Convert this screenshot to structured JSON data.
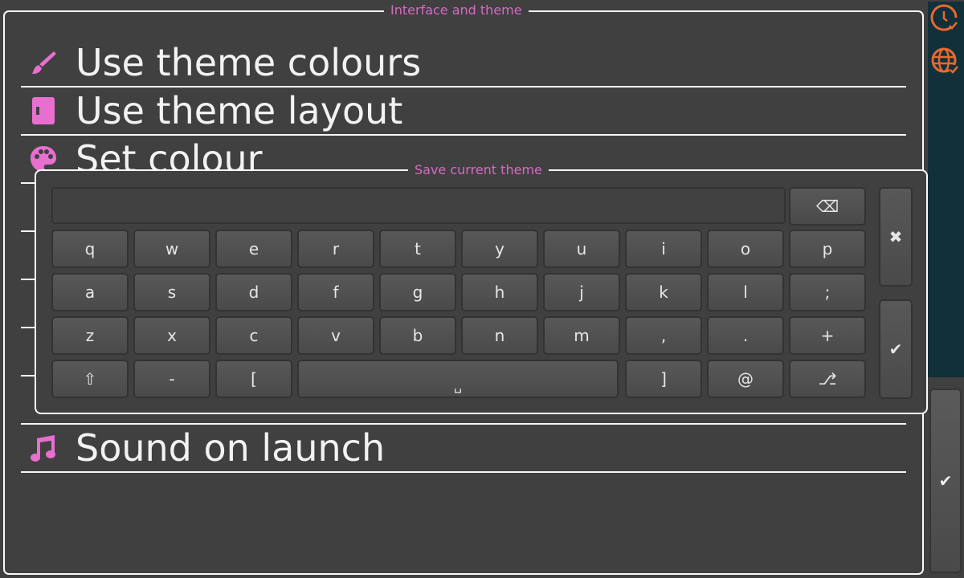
{
  "panel": {
    "title": "Interface and theme",
    "items": [
      {
        "label": "Use theme colours",
        "icon": "paintbrush-icon"
      },
      {
        "label": "Use theme layout",
        "icon": "layout-icon"
      },
      {
        "label": "Set colour",
        "icon": "palette-icon"
      },
      {
        "label": "",
        "icon": "hidden-icon"
      },
      {
        "label": "",
        "icon": "hidden-icon"
      },
      {
        "label": "",
        "icon": "hidden-icon"
      },
      {
        "label": "",
        "icon": "hidden-icon"
      },
      {
        "label": "",
        "icon": "hidden-icon"
      },
      {
        "label": "Sound on launch",
        "icon": "music-note-icon"
      }
    ]
  },
  "keyboard": {
    "title": "Save current theme",
    "input_value": "",
    "rows": [
      [
        "q",
        "w",
        "e",
        "r",
        "t",
        "y",
        "u",
        "i",
        "o",
        "p"
      ],
      [
        "a",
        "s",
        "d",
        "f",
        "g",
        "h",
        "j",
        "k",
        "l",
        ";"
      ],
      [
        "z",
        "x",
        "c",
        "v",
        "b",
        "n",
        "m",
        ",",
        ".",
        "+"
      ]
    ],
    "bottom_row": {
      "shift": "⇧",
      "dash": "-",
      "bracket_open": "[",
      "space": "␣",
      "bracket_close": "]",
      "at": "@",
      "layout": "⎇"
    },
    "backspace": "⌫",
    "cancel": "✖",
    "confirm": "✔"
  },
  "side": {
    "confirm": "✔",
    "accent": "#e8692f"
  },
  "colors": {
    "accent_pink": "#e86fd0",
    "title_pink": "#d66ac4",
    "background": "#404040",
    "sidebar_dark": "#11303a"
  }
}
